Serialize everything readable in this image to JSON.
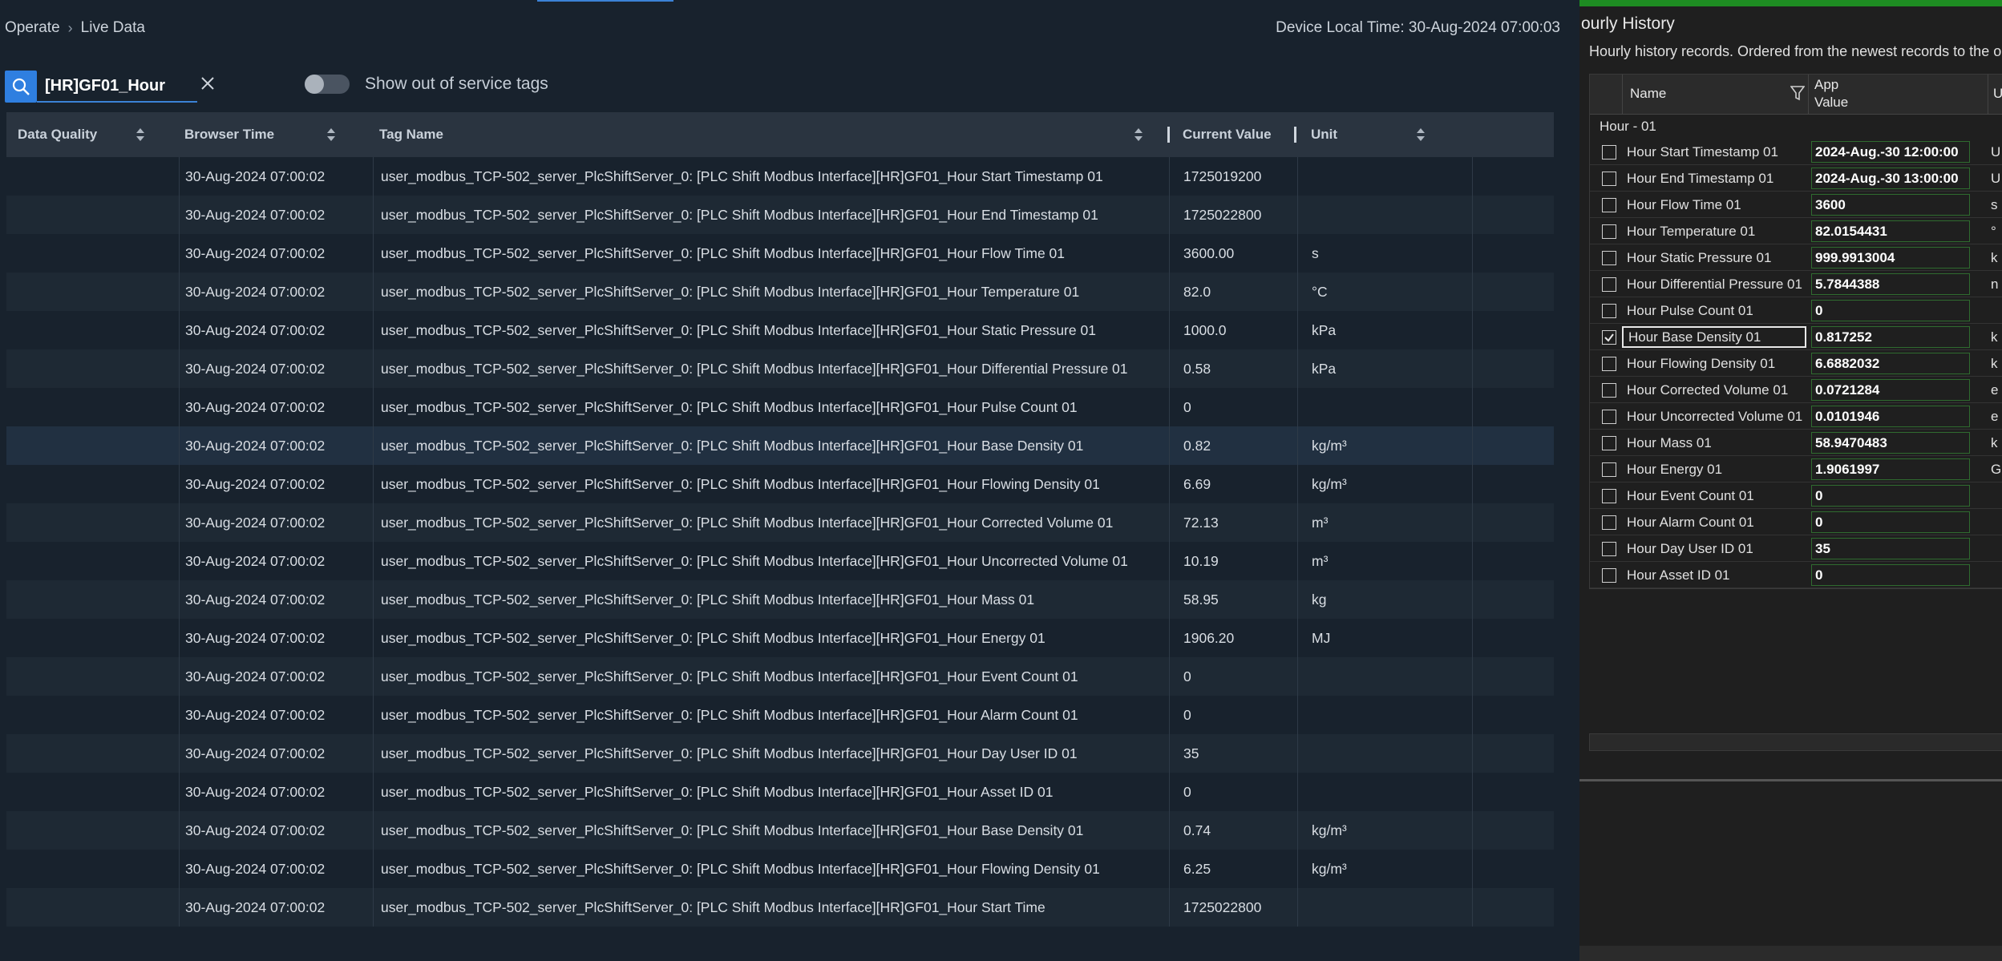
{
  "breadcrumb": {
    "root": "Operate",
    "current": "Live Data"
  },
  "device_time": "Device Local Time: 30-Aug-2024 07:00:03",
  "search": {
    "value": "[HR]GF01_Hour"
  },
  "toggle": {
    "label": "Show out of service tags",
    "on": false
  },
  "grid": {
    "headers": {
      "quality": "Data Quality",
      "time": "Browser Time",
      "tag": "Tag Name",
      "value": "Current Value",
      "unit": "Unit"
    },
    "rows": [
      {
        "time": "30-Aug-2024 07:00:02",
        "tag": "user_modbus_TCP-502_server_PlcShiftServer_0: [PLC Shift Modbus Interface][HR]GF01_Hour Start Timestamp 01",
        "value": "1725019200",
        "unit": ""
      },
      {
        "time": "30-Aug-2024 07:00:02",
        "tag": "user_modbus_TCP-502_server_PlcShiftServer_0: [PLC Shift Modbus Interface][HR]GF01_Hour End Timestamp 01",
        "value": "1725022800",
        "unit": ""
      },
      {
        "time": "30-Aug-2024 07:00:02",
        "tag": "user_modbus_TCP-502_server_PlcShiftServer_0: [PLC Shift Modbus Interface][HR]GF01_Hour Flow Time 01",
        "value": "3600.00",
        "unit": "s"
      },
      {
        "time": "30-Aug-2024 07:00:02",
        "tag": "user_modbus_TCP-502_server_PlcShiftServer_0: [PLC Shift Modbus Interface][HR]GF01_Hour Temperature 01",
        "value": "82.0",
        "unit": "°C"
      },
      {
        "time": "30-Aug-2024 07:00:02",
        "tag": "user_modbus_TCP-502_server_PlcShiftServer_0: [PLC Shift Modbus Interface][HR]GF01_Hour Static Pressure 01",
        "value": "1000.0",
        "unit": "kPa"
      },
      {
        "time": "30-Aug-2024 07:00:02",
        "tag": "user_modbus_TCP-502_server_PlcShiftServer_0: [PLC Shift Modbus Interface][HR]GF01_Hour Differential Pressure 01",
        "value": "0.58",
        "unit": "kPa"
      },
      {
        "time": "30-Aug-2024 07:00:02",
        "tag": "user_modbus_TCP-502_server_PlcShiftServer_0: [PLC Shift Modbus Interface][HR]GF01_Hour Pulse Count 01",
        "value": "0",
        "unit": ""
      },
      {
        "time": "30-Aug-2024 07:00:02",
        "tag": "user_modbus_TCP-502_server_PlcShiftServer_0: [PLC Shift Modbus Interface][HR]GF01_Hour Base Density 01",
        "value": "0.82",
        "unit": "kg/m³"
      },
      {
        "time": "30-Aug-2024 07:00:02",
        "tag": "user_modbus_TCP-502_server_PlcShiftServer_0: [PLC Shift Modbus Interface][HR]GF01_Hour Flowing Density 01",
        "value": "6.69",
        "unit": "kg/m³"
      },
      {
        "time": "30-Aug-2024 07:00:02",
        "tag": "user_modbus_TCP-502_server_PlcShiftServer_0: [PLC Shift Modbus Interface][HR]GF01_Hour Corrected Volume 01",
        "value": "72.13",
        "unit": "m³"
      },
      {
        "time": "30-Aug-2024 07:00:02",
        "tag": "user_modbus_TCP-502_server_PlcShiftServer_0: [PLC Shift Modbus Interface][HR]GF01_Hour Uncorrected Volume 01",
        "value": "10.19",
        "unit": "m³"
      },
      {
        "time": "30-Aug-2024 07:00:02",
        "tag": "user_modbus_TCP-502_server_PlcShiftServer_0: [PLC Shift Modbus Interface][HR]GF01_Hour Mass 01",
        "value": "58.95",
        "unit": "kg"
      },
      {
        "time": "30-Aug-2024 07:00:02",
        "tag": "user_modbus_TCP-502_server_PlcShiftServer_0: [PLC Shift Modbus Interface][HR]GF01_Hour Energy 01",
        "value": "1906.20",
        "unit": "MJ"
      },
      {
        "time": "30-Aug-2024 07:00:02",
        "tag": "user_modbus_TCP-502_server_PlcShiftServer_0: [PLC Shift Modbus Interface][HR]GF01_Hour Event Count 01",
        "value": "0",
        "unit": ""
      },
      {
        "time": "30-Aug-2024 07:00:02",
        "tag": "user_modbus_TCP-502_server_PlcShiftServer_0: [PLC Shift Modbus Interface][HR]GF01_Hour Alarm Count 01",
        "value": "0",
        "unit": ""
      },
      {
        "time": "30-Aug-2024 07:00:02",
        "tag": "user_modbus_TCP-502_server_PlcShiftServer_0: [PLC Shift Modbus Interface][HR]GF01_Hour Day User ID 01",
        "value": "35",
        "unit": ""
      },
      {
        "time": "30-Aug-2024 07:00:02",
        "tag": "user_modbus_TCP-502_server_PlcShiftServer_0: [PLC Shift Modbus Interface][HR]GF01_Hour Asset ID 01",
        "value": "0",
        "unit": ""
      },
      {
        "time": "30-Aug-2024 07:00:02",
        "tag": "user_modbus_TCP-502_server_PlcShiftServer_0: [PLC Shift Modbus Interface][HR]GF01_Hour Base Density 01",
        "value": "0.74",
        "unit": "kg/m³"
      },
      {
        "time": "30-Aug-2024 07:00:02",
        "tag": "user_modbus_TCP-502_server_PlcShiftServer_0: [PLC Shift Modbus Interface][HR]GF01_Hour Flowing Density 01",
        "value": "6.25",
        "unit": "kg/m³"
      },
      {
        "time": "30-Aug-2024 07:00:02",
        "tag": "user_modbus_TCP-502_server_PlcShiftServer_0: [PLC Shift Modbus Interface][HR]GF01_Hour Start Time",
        "value": "1725022800",
        "unit": ""
      }
    ]
  },
  "history": {
    "title": "ourly History",
    "subtitle": "Hourly history records. Ordered from the newest records to the o",
    "headers": {
      "name": "Name",
      "value": "App\nValue",
      "unit": "U"
    },
    "group": "Hour - 01",
    "rows": [
      {
        "name": "Hour Start Timestamp 01",
        "value": "2024-Aug.-30 12:00:00",
        "unit": "U",
        "checked": false
      },
      {
        "name": "Hour End Timestamp 01",
        "value": "2024-Aug.-30 13:00:00",
        "unit": "U",
        "checked": false
      },
      {
        "name": "Hour Flow Time 01",
        "value": "3600",
        "unit": "s",
        "checked": false
      },
      {
        "name": "Hour Temperature 01",
        "value": "82.0154431",
        "unit": "°",
        "checked": false
      },
      {
        "name": "Hour Static Pressure 01",
        "value": "999.9913004",
        "unit": "k",
        "checked": false
      },
      {
        "name": "Hour Differential Pressure 01",
        "value": "5.7844388",
        "unit": "n",
        "checked": false
      },
      {
        "name": "Hour Pulse Count 01",
        "value": "0",
        "unit": "",
        "checked": false
      },
      {
        "name": "Hour Base Density 01",
        "value": "0.817252",
        "unit": "k",
        "checked": true
      },
      {
        "name": "Hour Flowing Density 01",
        "value": "6.6882032",
        "unit": "k",
        "checked": false
      },
      {
        "name": "Hour Corrected Volume 01",
        "value": "0.0721284",
        "unit": "e",
        "checked": false
      },
      {
        "name": "Hour Uncorrected Volume 01",
        "value": "0.0101946",
        "unit": "e",
        "checked": false
      },
      {
        "name": "Hour Mass 01",
        "value": "58.9470483",
        "unit": "k",
        "checked": false
      },
      {
        "name": "Hour Energy 01",
        "value": "1.9061997",
        "unit": "G",
        "checked": false
      },
      {
        "name": "Hour Event Count 01",
        "value": "0",
        "unit": "",
        "checked": false
      },
      {
        "name": "Hour Alarm Count 01",
        "value": "0",
        "unit": "",
        "checked": false
      },
      {
        "name": "Hour Day User ID 01",
        "value": "35",
        "unit": "",
        "checked": false
      },
      {
        "name": "Hour Asset ID 01",
        "value": "0",
        "unit": "",
        "checked": false
      }
    ]
  },
  "colors": {
    "accent": "#2f7fe0",
    "green_bar": "#1e8c22",
    "bg": "#18222d"
  }
}
